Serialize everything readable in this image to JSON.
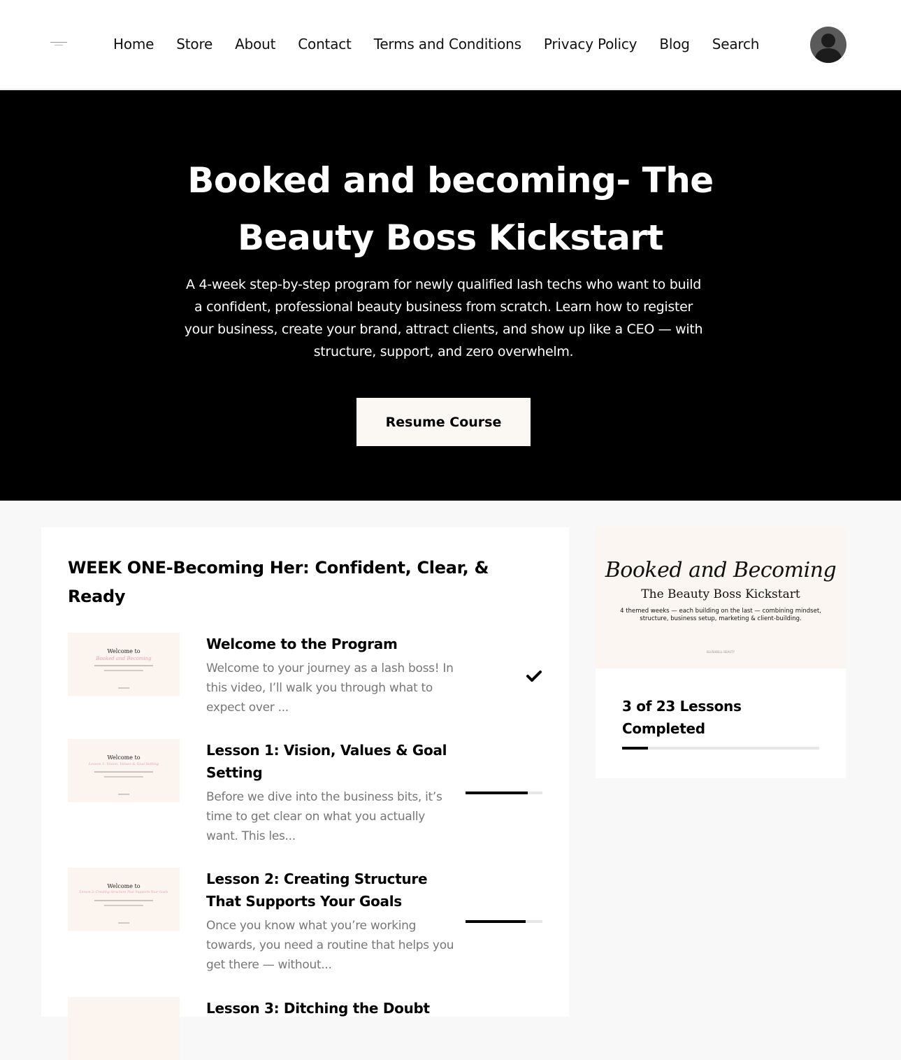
{
  "nav": {
    "links": [
      "Home",
      "Store",
      "About",
      "Contact",
      "Terms and Conditions",
      "Privacy Policy",
      "Blog",
      "Search"
    ]
  },
  "hero": {
    "title": "Booked and becoming- The Beauty Boss Kickstart",
    "subtitle": "A 4-week step-by-step program for newly qualified lash techs who want to build a confident, professional beauty business from scratch. Learn how to register your business, create your brand, attract clients, and show up like a CEO — with structure, support, and zero overwhelm.",
    "button_label": "Resume Course"
  },
  "week": {
    "title": "WEEK ONE-Becoming Her: Confident, Clear, & Ready"
  },
  "lessons": [
    {
      "title": "Welcome to the Program",
      "description": "Welcome to your journey as a lash boss! In this video, I’ll walk you through what to expect over ...",
      "status": "completed",
      "thumb_heading": "Welcome to",
      "thumb_script": "Booked and Becoming"
    },
    {
      "title": "Lesson 1: Vision, Values & Goal Setting",
      "description": "Before we dive into the business bits, it’s time to get clear on what you actually want. This les...",
      "status": "in-progress",
      "progress": 0.81,
      "thumb_heading": "Welcome to",
      "thumb_script": "Lesson 1: Vision, Values & Goal Setting"
    },
    {
      "title": "Lesson 2: Creating Structure That Supports Your Goals",
      "description": "Once you know what you’re working towards, you need a routine that helps you get there — without...",
      "status": "in-progress",
      "progress": 0.78,
      "thumb_heading": "Welcome to",
      "thumb_script": "Lesson 2: Creating Structure That Supports Your Goals"
    },
    {
      "title": "Lesson 3: Ditching the Doubt",
      "description": "",
      "status": "not-started",
      "thumb_heading": "",
      "thumb_script": ""
    }
  ],
  "sidebar": {
    "cover_title": "Booked and Becoming",
    "cover_subtitle": "The Beauty Boss Kickstart",
    "cover_note": "4 themed weeks — each building on the last — combining mindset, structure, business setup, marketing & client-building.",
    "cover_brand": "BLUSHBELL BEAUTY",
    "progress_text": "3 of 23 Lessons Completed",
    "lessons_completed": 3,
    "lessons_total": 23
  },
  "colors": {
    "hero_bg": "#000000",
    "button_bg": "#fbf7f3",
    "page_bg": "#f8f8f8",
    "muted_text": "#777777"
  }
}
